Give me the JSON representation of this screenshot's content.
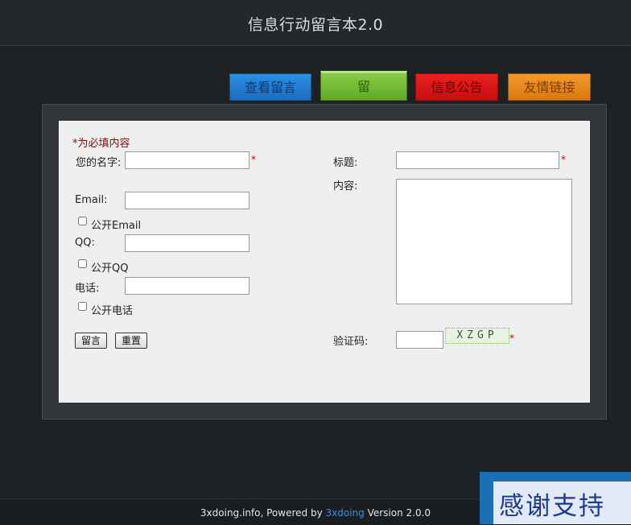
{
  "header": {
    "title": "信息行动留言本2.0"
  },
  "nav": {
    "view_messages": "查看留言",
    "post_message": "留言",
    "notice": "信息公告",
    "friend_links": "友情链接"
  },
  "form": {
    "required_note": "*为必填内容",
    "required_mark": "*",
    "name_label": "您的名字:",
    "email_label": "Email:",
    "public_email_label": "公开Email",
    "qq_label": "QQ:",
    "public_qq_label": "公开QQ",
    "phone_label": "电话:",
    "public_phone_label": "公开电话",
    "title_label": "标题:",
    "content_label": "内容:",
    "captcha_label": "验证码:",
    "captcha_text": "XZGP",
    "submit_label": "留言",
    "reset_label": "重置",
    "name_value": "",
    "email_value": "",
    "qq_value": "",
    "phone_value": "",
    "title_value": "",
    "content_value": "",
    "captcha_value": "",
    "public_email_checked": false,
    "public_qq_checked": false,
    "public_phone_checked": false
  },
  "footer": {
    "prefix": "3xdoing.info, Powered by ",
    "link": "3xdoing",
    "suffix": " Version 2.0.0"
  },
  "banner": {
    "text": "感谢支持"
  },
  "colors": {
    "background": "#1e2124",
    "nav_view": "#1b6cc0",
    "nav_post": "#62a826",
    "nav_notice": "#c40e0e",
    "nav_links": "#d9770e",
    "required": "#cc0000",
    "footer_link": "#3f8fd8"
  }
}
